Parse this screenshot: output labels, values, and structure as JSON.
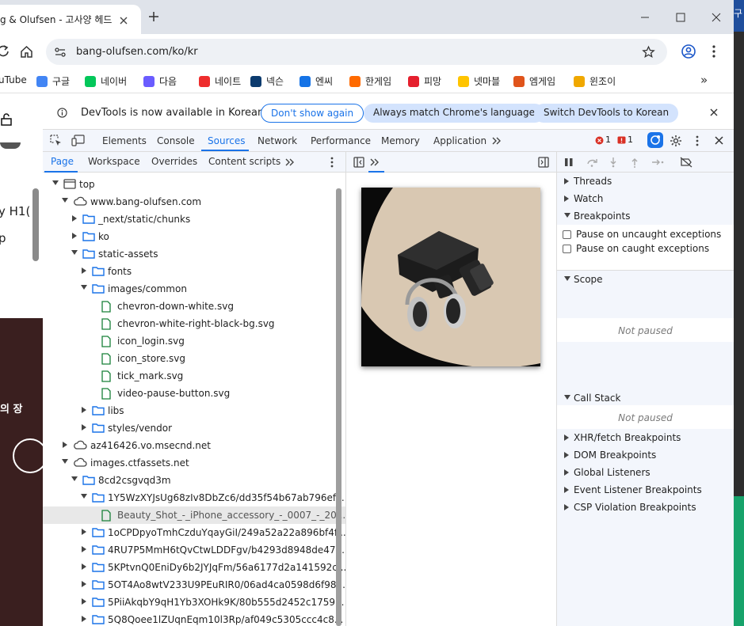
{
  "browser": {
    "tab_title": "g & Olufsen - 고사양 헤드",
    "url": "bang-olufsen.com/ko/kr",
    "bookmarks": [
      {
        "label": "uTube",
        "icon": "youtube-icon",
        "color": "#ff0000"
      },
      {
        "label": "구글",
        "icon": "google-icon",
        "color": "#4285f4"
      },
      {
        "label": "네이버",
        "icon": "naver-icon",
        "color": "#03c75a"
      },
      {
        "label": "다음",
        "icon": "daum-icon",
        "color": "#6a5cff"
      },
      {
        "label": "네이트",
        "icon": "nate-icon",
        "color": "#ee2d2d"
      },
      {
        "label": "넥슨",
        "icon": "nexon-icon",
        "color": "#0c3b6e"
      },
      {
        "label": "엔씨",
        "icon": "nc-icon",
        "color": "#1573e6"
      },
      {
        "label": "한게임",
        "icon": "hangame-icon",
        "color": "#ff6a00"
      },
      {
        "label": "피망",
        "icon": "pmang-icon",
        "color": "#e5202e"
      },
      {
        "label": "넷마블",
        "icon": "netmarble-icon",
        "color": "#ffc400"
      },
      {
        "label": "엠게임",
        "icon": "mgame-icon",
        "color": "#e0541b"
      },
      {
        "label": "윈조이",
        "icon": "winjoy-icon",
        "color": "#f0a800"
      }
    ]
  },
  "page_partial": {
    "t1": "y H1(",
    "t2": "p",
    "t3": "의 장",
    "t4": "구"
  },
  "infobar": {
    "message": "DevTools is now available in Korean",
    "btn_dont_show": "Don't show again",
    "btn_match": "Always match Chrome's language",
    "btn_switch": "Switch DevTools to Korean"
  },
  "main_tabs": [
    "Elements",
    "Console",
    "Sources",
    "Network",
    "Performance",
    "Memory",
    "Application"
  ],
  "active_tab": "Sources",
  "error_count": "1",
  "issue_count": "1",
  "navigator_tabs": [
    "Page",
    "Workspace",
    "Overrides",
    "Content scripts"
  ],
  "tree": [
    {
      "label": "top",
      "depth": 0,
      "arrow": "down",
      "icon": "frame"
    },
    {
      "label": "www.bang-olufsen.com",
      "depth": 1,
      "arrow": "down",
      "icon": "cloud"
    },
    {
      "label": "_next/static/chunks",
      "depth": 2,
      "arrow": "right",
      "icon": "folder"
    },
    {
      "label": "ko",
      "depth": 2,
      "arrow": "right",
      "icon": "folder"
    },
    {
      "label": "static-assets",
      "depth": 2,
      "arrow": "down",
      "icon": "folder"
    },
    {
      "label": "fonts",
      "depth": 3,
      "arrow": "right",
      "icon": "folder"
    },
    {
      "label": "images/common",
      "depth": 3,
      "arrow": "down",
      "icon": "folder"
    },
    {
      "label": "chevron-down-white.svg",
      "depth": 4,
      "arrow": "",
      "icon": "file"
    },
    {
      "label": "chevron-white-right-black-bg.svg",
      "depth": 4,
      "arrow": "",
      "icon": "file"
    },
    {
      "label": "icon_login.svg",
      "depth": 4,
      "arrow": "",
      "icon": "file"
    },
    {
      "label": "icon_store.svg",
      "depth": 4,
      "arrow": "",
      "icon": "file"
    },
    {
      "label": "tick_mark.svg",
      "depth": 4,
      "arrow": "",
      "icon": "file"
    },
    {
      "label": "video-pause-button.svg",
      "depth": 4,
      "arrow": "",
      "icon": "file"
    },
    {
      "label": "libs",
      "depth": 3,
      "arrow": "right",
      "icon": "folder"
    },
    {
      "label": "styles/vendor",
      "depth": 3,
      "arrow": "right",
      "icon": "folder"
    },
    {
      "label": "az416426.vo.msecnd.net",
      "depth": 1,
      "arrow": "right",
      "icon": "cloud"
    },
    {
      "label": "images.ctfassets.net",
      "depth": 1,
      "arrow": "down",
      "icon": "cloud"
    },
    {
      "label": "8cd2csgvqd3m",
      "depth": 2,
      "arrow": "down",
      "icon": "folder"
    },
    {
      "label": "1Y5WzXYJsUg68zIv8DbZc6/dd35f54b67ab796ef...",
      "depth": 3,
      "arrow": "down",
      "icon": "folder"
    },
    {
      "label": "Beauty_Shot_-_iPhone_accessory_-_0007_-_20...",
      "depth": 4,
      "arrow": "",
      "icon": "file",
      "selected": true
    },
    {
      "label": "1oCPDpyoTmhCzduYqayGiI/249a52a22a896bf4f...",
      "depth": 3,
      "arrow": "right",
      "icon": "folder"
    },
    {
      "label": "4RU7P5MmH6tQvCtwLDDFgv/b4293d8948de47...",
      "depth": 3,
      "arrow": "right",
      "icon": "folder"
    },
    {
      "label": "5KPtvnQ0EniDy6b2JYJqFm/56a6177d2a141592c...",
      "depth": 3,
      "arrow": "right",
      "icon": "folder"
    },
    {
      "label": "5OT4Ao8wtV233U9PEuRIR0/06ad4ca0598d6f98...",
      "depth": 3,
      "arrow": "right",
      "icon": "folder"
    },
    {
      "label": "5PiiAkqbY9qH1Yb3XOHk9K/80b555d2452c1759...",
      "depth": 3,
      "arrow": "right",
      "icon": "folder"
    },
    {
      "label": "5Q8Qoee1lZUqnEqm10l3Rp/af049c5305ccc4c8...",
      "depth": 3,
      "arrow": "right",
      "icon": "folder"
    }
  ],
  "debugger": {
    "sections": [
      {
        "label": "Threads",
        "open": false
      },
      {
        "label": "Watch",
        "open": false
      },
      {
        "label": "Breakpoints",
        "open": true
      }
    ],
    "pause_uncaught": "Pause on uncaught exceptions",
    "pause_caught": "Pause on caught exceptions",
    "scope": "Scope",
    "scope_empty": "Not paused",
    "callstack": "Call Stack",
    "callstack_empty": "Not paused",
    "bottom_sections": [
      "XHR/fetch Breakpoints",
      "DOM Breakpoints",
      "Global Listeners",
      "Event Listener Breakpoints",
      "CSP Violation Breakpoints"
    ]
  },
  "colors": {
    "accent": "#1a73e8",
    "error": "#d93025",
    "folder": "#1a73e8",
    "file": "#188038"
  }
}
